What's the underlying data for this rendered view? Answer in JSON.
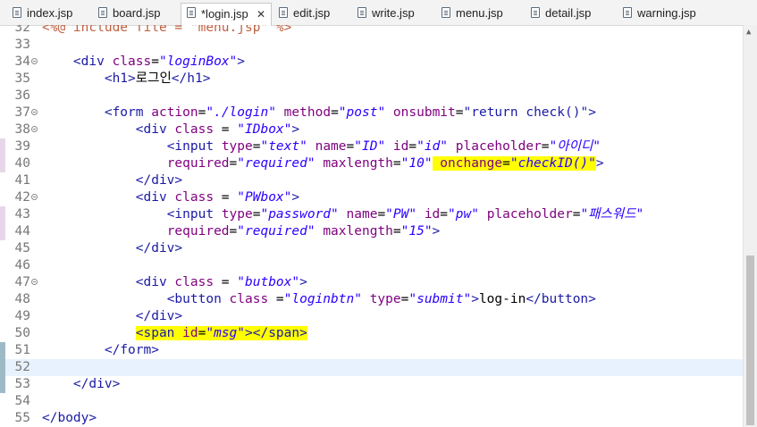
{
  "tabs": [
    {
      "label": "index.jsp",
      "active": false
    },
    {
      "label": "board.jsp",
      "active": false
    },
    {
      "label": "*login.jsp",
      "active": true
    },
    {
      "label": "edit.jsp",
      "active": false
    },
    {
      "label": "write.jsp",
      "active": false
    },
    {
      "label": "menu.jsp",
      "active": false
    },
    {
      "label": "detail.jsp",
      "active": false
    },
    {
      "label": "warning.jsp",
      "active": false
    }
  ],
  "close_glyph": "✕",
  "lines": [
    {
      "n": "32",
      "t": "<%@ include file = \"menu.jsp\" %>"
    },
    {
      "n": "33",
      "t": ""
    },
    {
      "n": "34",
      "t": "    <div class=\"loginBox\">"
    },
    {
      "n": "35",
      "t": "        <h1>로그인</h1>"
    },
    {
      "n": "36",
      "t": ""
    },
    {
      "n": "37",
      "t": "        <form action=\"./login\" method=\"post\" onsubmit=\"return check()\">"
    },
    {
      "n": "38",
      "t": "            <div class = \"IDbox\">"
    },
    {
      "n": "39",
      "t": "                <input type=\"text\" name=\"ID\" id=\"id\" placeholder=\"아이디\""
    },
    {
      "n": "40",
      "t": "                required=\"required\" maxlength=\"10\" onchange=\"checkID()\">"
    },
    {
      "n": "41",
      "t": "            </div>"
    },
    {
      "n": "42",
      "t": "            <div class = \"PWbox\">"
    },
    {
      "n": "43",
      "t": "                <input type=\"password\" name=\"PW\" id=\"pw\" placeholder=\"패스워드\""
    },
    {
      "n": "44",
      "t": "                required=\"required\" maxlength=\"15\">"
    },
    {
      "n": "45",
      "t": "            </div>"
    },
    {
      "n": "46",
      "t": ""
    },
    {
      "n": "47",
      "t": "            <div class = \"butbox\">"
    },
    {
      "n": "48",
      "t": "                <button class =\"loginbtn\" type=\"submit\">log-in</button>"
    },
    {
      "n": "49",
      "t": "            </div>"
    },
    {
      "n": "50",
      "t": "            <span id=\"msg\"></span>"
    },
    {
      "n": "51",
      "t": "        </form>"
    },
    {
      "n": "52",
      "t": ""
    },
    {
      "n": "53",
      "t": "    </div>"
    },
    {
      "n": "54",
      "t": ""
    },
    {
      "n": "55",
      "t": "</body>"
    }
  ]
}
